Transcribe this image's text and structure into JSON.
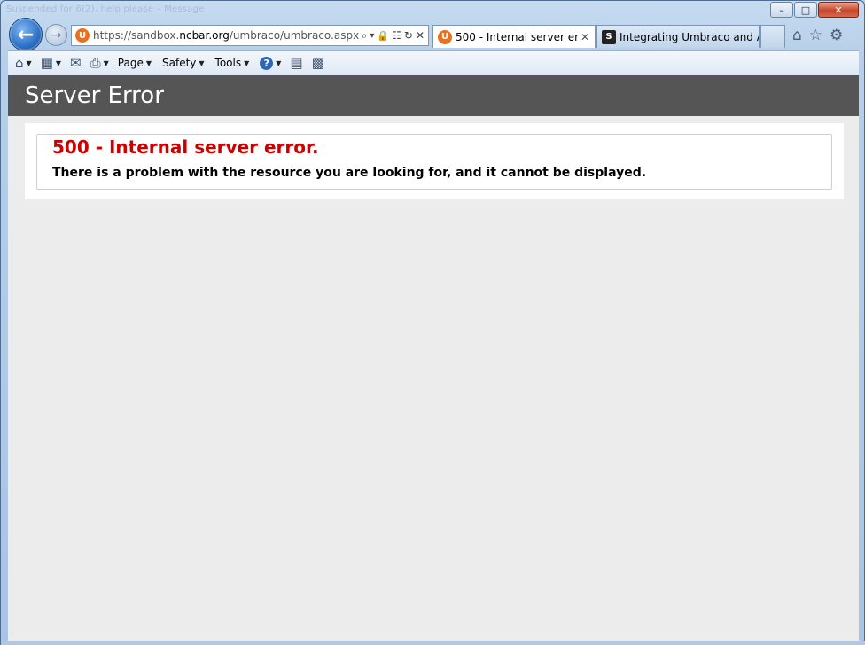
{
  "window": {
    "title_text": "Suspended for 6(2), help please – Message",
    "minimize_glyph": "–",
    "maximize_glyph": "□",
    "close_glyph": "✕"
  },
  "nav": {
    "back_icon": "back-arrow-icon",
    "forward_icon": "forward-arrow-icon",
    "back_glyph": "←",
    "forward_glyph": "→"
  },
  "address": {
    "url_prefix": "https://sandbox.",
    "url_host": "ncbar.org",
    "url_path": "/umbraco/umbraco.aspx",
    "site_icon_glyph": "U",
    "icons": [
      "search-icon",
      "dropdown-icon",
      "lock-icon",
      "compat-icon",
      "refresh-icon",
      "stop-icon"
    ],
    "icon_glyphs": [
      "⌕",
      "▾",
      "🔒",
      "☷",
      "↻",
      "✕"
    ]
  },
  "tabs": [
    {
      "label": "500 - Internal server error.",
      "fav_glyph": "U",
      "close_glyph": "✕"
    },
    {
      "label": "Integrating Umbraco and A...",
      "fav_glyph": "S"
    }
  ],
  "toolbar_right": {
    "icons": [
      "home-icon",
      "favorites-icon",
      "gear-icon"
    ],
    "glyphs": [
      "⌂",
      "☆",
      "⚙"
    ]
  },
  "commandbar": {
    "home_glyph": "⌂",
    "feeds_glyph": "▦",
    "mail_glyph": "✉",
    "print_glyph": "⎙",
    "page_label": "Page",
    "safety_label": "Safety",
    "tools_label": "Tools",
    "help_glyph": "?",
    "research_glyph": "▤",
    "extra_glyph": "▩",
    "dd_glyph": "▼"
  },
  "page": {
    "header_title": "Server Error",
    "error_title": "500 - Internal server error.",
    "error_description": "There is a problem with the resource you are looking for, and it cannot be displayed."
  },
  "colors": {
    "header_band": "#555555",
    "error_red": "#cc0000",
    "page_bg": "#ececec"
  }
}
